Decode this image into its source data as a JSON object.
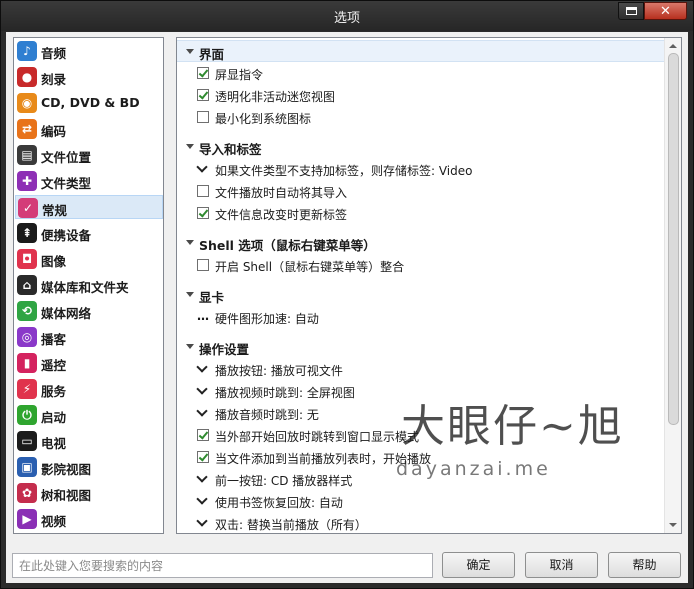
{
  "window": {
    "title": "选项"
  },
  "sidebar": {
    "items": [
      {
        "label": "音频",
        "icon": "music-note-icon",
        "color": "#2f7fd1",
        "glyph": "♪"
      },
      {
        "label": "刻录",
        "icon": "burn-disc-icon",
        "color": "#c82a2a",
        "glyph": "●"
      },
      {
        "label": "CD, DVD & BD",
        "icon": "disc-icon",
        "color": "#e88a1a",
        "glyph": "◉"
      },
      {
        "label": "编码",
        "icon": "convert-icon",
        "color": "#e8731a",
        "glyph": "⇄"
      },
      {
        "label": "文件位置",
        "icon": "folder-icon",
        "color": "#3a3a3a",
        "glyph": "▤"
      },
      {
        "label": "文件类型",
        "icon": "puzzle-icon",
        "color": "#8e2fb5",
        "glyph": "✚"
      },
      {
        "label": "常规",
        "icon": "checkbox-icon",
        "color": "#d43c78",
        "glyph": "✓"
      },
      {
        "label": "便携设备",
        "icon": "usb-icon",
        "color": "#1b1b1b",
        "glyph": "⇞"
      },
      {
        "label": "图像",
        "icon": "camera-icon",
        "color": "#e0334d",
        "glyph": "◘"
      },
      {
        "label": "媒体库和文件夹",
        "icon": "library-icon",
        "color": "#2a2a2a",
        "glyph": "⌂"
      },
      {
        "label": "媒体网络",
        "icon": "network-icon",
        "color": "#2fa543",
        "glyph": "⟲"
      },
      {
        "label": "播客",
        "icon": "podcast-icon",
        "color": "#8a38c9",
        "glyph": "◎"
      },
      {
        "label": "遥控",
        "icon": "remote-icon",
        "color": "#d4235f",
        "glyph": "▮"
      },
      {
        "label": "服务",
        "icon": "plug-icon",
        "color": "#e0334d",
        "glyph": "⚡"
      },
      {
        "label": "启动",
        "icon": "power-icon",
        "color": "#2fa52f",
        "glyph": "⏻"
      },
      {
        "label": "电视",
        "icon": "tv-icon",
        "color": "#1b1b1b",
        "glyph": "▭"
      },
      {
        "label": "影院视图",
        "icon": "monitor-icon",
        "color": "#2a5fb0",
        "glyph": "▣"
      },
      {
        "label": "树和视图",
        "icon": "tree-view-icon",
        "color": "#c42d4d",
        "glyph": "✿"
      },
      {
        "label": "视频",
        "icon": "film-camera-icon",
        "color": "#8a2fb5",
        "glyph": "▶"
      }
    ],
    "selected": "常规"
  },
  "panel": {
    "sections": [
      {
        "title": "界面",
        "rows": [
          {
            "kind": "checkbox",
            "checked": true,
            "text": "屏显指令"
          },
          {
            "kind": "checkbox",
            "checked": true,
            "text": "透明化非活动迷您视图"
          },
          {
            "kind": "checkbox",
            "checked": false,
            "text": "最小化到系统图标"
          }
        ]
      },
      {
        "title": "导入和标签",
        "rows": [
          {
            "kind": "option",
            "text": "如果文件类型不支持加标签，则存储标签: Video"
          },
          {
            "kind": "checkbox",
            "checked": false,
            "text": "文件播放时自动将其导入"
          },
          {
            "kind": "checkbox",
            "checked": true,
            "text": "文件信息改变时更新标签"
          }
        ]
      },
      {
        "title": "Shell 选项（鼠标右键菜单等）",
        "rows": [
          {
            "kind": "checkbox",
            "checked": false,
            "text": "开启 Shell（鼠标右键菜单等）整合"
          }
        ]
      },
      {
        "title": "显卡",
        "rows": [
          {
            "kind": "dots",
            "text": "硬件图形加速: 自动"
          }
        ]
      },
      {
        "title": "操作设置",
        "rows": [
          {
            "kind": "option",
            "text": "播放按钮: 播放可视文件"
          },
          {
            "kind": "option",
            "text": "播放视频时跳到: 全屏视图"
          },
          {
            "kind": "option",
            "text": "播放音频时跳到: 无"
          },
          {
            "kind": "checkbox",
            "checked": true,
            "text": "当外部开始回放时跳转到窗口显示模式"
          },
          {
            "kind": "checkbox",
            "checked": true,
            "text": "当文件添加到当前播放列表时，开始播放"
          },
          {
            "kind": "option",
            "text": "前一按钮: CD 播放器样式"
          },
          {
            "kind": "option",
            "text": "使用书签恢复回放: 自动"
          },
          {
            "kind": "option",
            "text": "双击: 替换当前播放（所有）"
          }
        ]
      }
    ]
  },
  "footer": {
    "search_placeholder": "在此处键入您要搜索的内容",
    "ok_label": "确定",
    "cancel_label": "取消",
    "help_label": "帮助"
  },
  "watermark": {
    "big": "大眼仔~旭",
    "small": "dayanzai.me"
  }
}
